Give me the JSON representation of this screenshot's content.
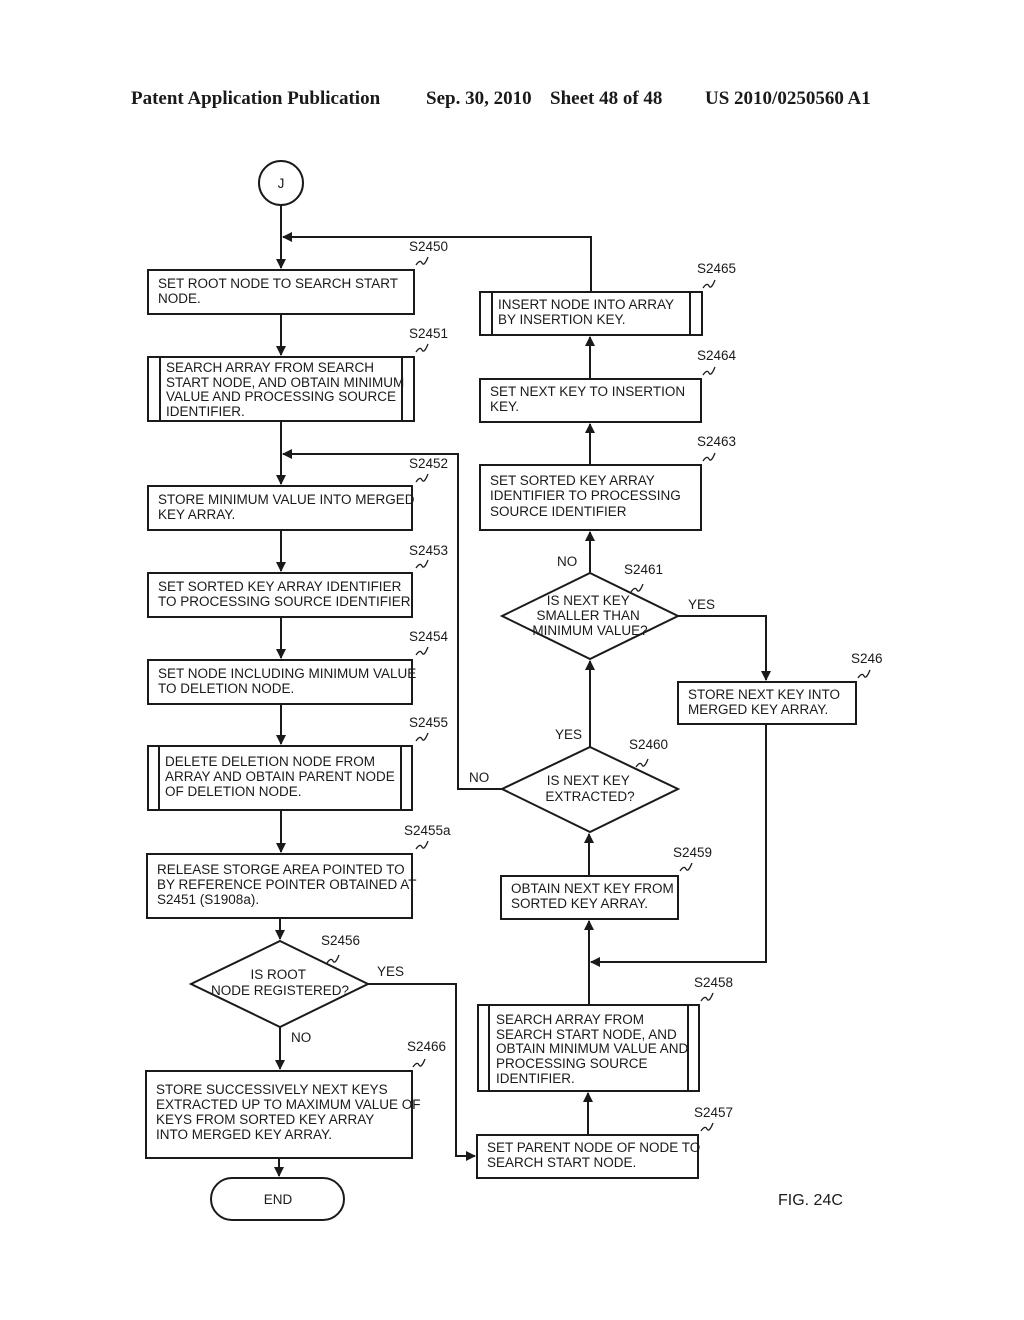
{
  "header": {
    "publication": "Patent Application Publication",
    "date": "Sep. 30, 2010",
    "sheet": "Sheet 48 of 48",
    "number": "US 2010/0250560 A1"
  },
  "figure_label": "FIG. 24C",
  "connector": {
    "label": "J"
  },
  "terminal": {
    "label": "END"
  },
  "steps": {
    "s2450": {
      "id": "S2450",
      "lines": [
        "SET ROOT NODE TO SEARCH START",
        "NODE."
      ]
    },
    "s2451": {
      "id": "S2451",
      "lines": [
        "SEARCH ARRAY FROM SEARCH",
        "START NODE, AND OBTAIN MINIMUM",
        "VALUE AND PROCESSING SOURCE",
        "IDENTIFIER."
      ]
    },
    "s2452": {
      "id": "S2452",
      "lines": [
        "STORE MINIMUM VALUE INTO MERGED",
        "KEY ARRAY."
      ]
    },
    "s2453": {
      "id": "S2453",
      "lines": [
        "SET SORTED KEY ARRAY IDENTIFIER",
        "TO PROCESSING SOURCE IDENTIFIER"
      ]
    },
    "s2454": {
      "id": "S2454",
      "lines": [
        "SET NODE INCLUDING MINIMUM VALUE",
        "TO DELETION NODE."
      ]
    },
    "s2455": {
      "id": "S2455",
      "lines": [
        "DELETE DELETION NODE FROM",
        "ARRAY AND OBTAIN PARENT NODE",
        "OF DELETION NODE."
      ]
    },
    "s2455a": {
      "id": "S2455a",
      "lines": [
        "RELEASE STORGE AREA POINTED TO",
        "BY REFERENCE POINTER OBTAINED AT",
        "S2451 (S1908a)."
      ]
    },
    "s2456": {
      "id": "S2456",
      "lines": [
        "IS ROOT",
        "NODE  REGISTERED?"
      ]
    },
    "s2466": {
      "id": "S2466",
      "lines": [
        "STORE SUCCESSIVELY NEXT KEYS",
        "EXTRACTED UP TO MAXIMUM VALUE OF",
        "KEYS FROM SORTED KEY ARRAY",
        "INTO MERGED KEY ARRAY."
      ]
    },
    "s2457": {
      "id": "S2457",
      "lines": [
        "SET PARENT NODE OF NODE TO",
        "SEARCH START NODE."
      ]
    },
    "s2458": {
      "id": "S2458",
      "lines": [
        "SEARCH ARRAY FROM",
        "SEARCH START NODE, AND",
        "OBTAIN MINIMUM VALUE AND",
        "PROCESSING SOURCE",
        "IDENTIFIER."
      ]
    },
    "s2459": {
      "id": "S2459",
      "lines": [
        "OBTAIN NEXT KEY FROM",
        "SORTED KEY ARRAY."
      ]
    },
    "s2460": {
      "id": "S2460",
      "lines": [
        "IS NEXT KEY",
        "EXTRACTED?"
      ]
    },
    "s2461": {
      "id": "S2461",
      "lines": [
        "IS NEXT KEY",
        "SMALLER THAN",
        "MINIMUM VALUE?"
      ]
    },
    "s2462": {
      "id": "S246",
      "lines": [
        "STORE NEXT KEY INTO",
        "MERGED KEY ARRAY."
      ]
    },
    "s2463": {
      "id": "S2463",
      "lines": [
        "SET SORTED KEY ARRAY",
        "IDENTIFIER TO PROCESSING",
        "SOURCE IDENTIFIER"
      ]
    },
    "s2464": {
      "id": "S2464",
      "lines": [
        "SET NEXT KEY TO INSERTION",
        "KEY."
      ]
    },
    "s2465": {
      "id": "S2465",
      "lines": [
        "INSERT NODE INTO ARRAY",
        "BY INSERTION KEY."
      ]
    }
  },
  "branch_labels": {
    "s2456_yes": "YES",
    "s2456_no": "NO",
    "s2460_yes": "YES",
    "s2460_no": "NO",
    "s2461_yes": "YES",
    "s2461_no": "NO"
  }
}
